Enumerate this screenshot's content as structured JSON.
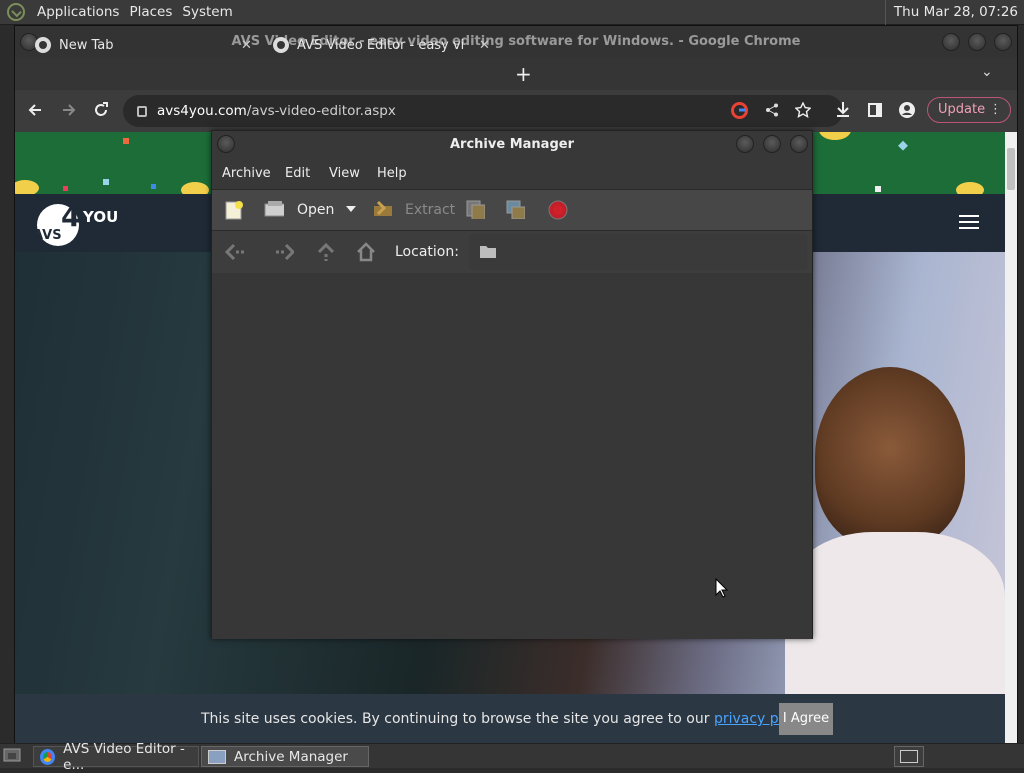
{
  "top_panel": {
    "menus": [
      "Applications",
      "Places",
      "System"
    ],
    "clock": "Thu Mar 28, 07:26"
  },
  "chrome": {
    "title": "AVS Video Editor - easy video editing software for Windows. - Google Chrome",
    "tabs": [
      {
        "label": "New Tab",
        "close": "✕"
      },
      {
        "label": "AVS Video Editor - easy video",
        "close": "✕"
      }
    ],
    "new_tab": "+",
    "tab_menu": "⌄",
    "url_domain": "avs4you.com",
    "url_path": "/avs-video-editor.aspx",
    "update_label": "Update"
  },
  "website": {
    "logo_four": "4",
    "logo_you": "YOU",
    "logo_avs": "AVS",
    "cookie_text": "This site uses cookies. By continuing to browse the site you agree to our",
    "cookie_link": "privacy policy",
    "cookie_end": ".",
    "agree_label": "I Agree"
  },
  "archive_manager": {
    "title": "Archive Manager",
    "menus": [
      "Archive",
      "Edit",
      "View",
      "Help"
    ],
    "toolbar": {
      "open": "Open",
      "extract": "Extract"
    },
    "location_label": "Location:"
  },
  "taskbar": {
    "items": [
      {
        "label": "AVS Video Editor - e..."
      },
      {
        "label": "Archive Manager"
      }
    ]
  }
}
